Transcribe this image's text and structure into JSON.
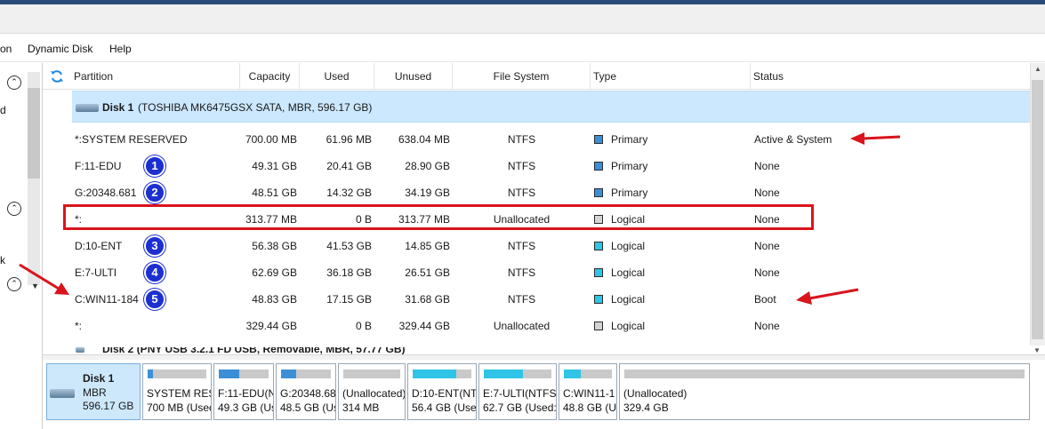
{
  "menu": {
    "item_partial": "on",
    "dynamic_disk": "Dynamic Disk",
    "help": "Help"
  },
  "left_panel": {
    "text_d": "d",
    "text_k": "k"
  },
  "table": {
    "headers": {
      "partition": "Partition",
      "capacity": "Capacity",
      "used": "Used",
      "unused": "Unused",
      "file_system": "File System",
      "type": "Type",
      "status": "Status"
    },
    "disk1_label": "Disk 1",
    "disk1_details": "(TOSHIBA MK6475GSX SATA, MBR, 596.17 GB)",
    "disk2_label_partial": "Disk 2 (PNY USB 3.2.1 FD USB, Removable, MBR, 57.77 GB)",
    "rows": [
      {
        "partition": "*:SYSTEM RESERVED",
        "capacity": "700.00 MB",
        "used": "61.96 MB",
        "unused": "638.04 MB",
        "fs": "NTFS",
        "type": "Primary",
        "status": "Active & System",
        "type_color": "#3c8fd6",
        "badge": ""
      },
      {
        "partition": "F:11-EDU",
        "capacity": "49.31 GB",
        "used": "20.41 GB",
        "unused": "28.90 GB",
        "fs": "NTFS",
        "type": "Primary",
        "status": "None",
        "type_color": "#3c8fd6",
        "badge": "1"
      },
      {
        "partition": "G:20348.681",
        "capacity": "48.51 GB",
        "used": "14.32 GB",
        "unused": "34.19 GB",
        "fs": "NTFS",
        "type": "Primary",
        "status": "None",
        "type_color": "#3c8fd6",
        "badge": "2"
      },
      {
        "partition": "*:",
        "capacity": "313.77 MB",
        "used": "0 B",
        "unused": "313.77 MB",
        "fs": "Unallocated",
        "type": "Logical",
        "status": "None",
        "type_color": "#d4d4d4",
        "badge": ""
      },
      {
        "partition": "D:10-ENT",
        "capacity": "56.38 GB",
        "used": "41.53 GB",
        "unused": "14.85 GB",
        "fs": "NTFS",
        "type": "Logical",
        "status": "None",
        "type_color": "#30c4e6",
        "badge": "3"
      },
      {
        "partition": "E:7-ULTI",
        "capacity": "62.69 GB",
        "used": "36.18 GB",
        "unused": "26.51 GB",
        "fs": "NTFS",
        "type": "Logical",
        "status": "None",
        "type_color": "#30c4e6",
        "badge": "4"
      },
      {
        "partition": "C:WIN11-184",
        "capacity": "48.83 GB",
        "used": "17.15 GB",
        "unused": "31.68 GB",
        "fs": "NTFS",
        "type": "Logical",
        "status": "Boot",
        "type_color": "#30c4e6",
        "badge": "5"
      },
      {
        "partition": "*:",
        "capacity": "329.44 GB",
        "used": "0 B",
        "unused": "329.44 GB",
        "fs": "Unallocated",
        "type": "Logical",
        "status": "None",
        "type_color": "#d4d4d4",
        "badge": ""
      }
    ]
  },
  "disk_map": {
    "disk_name": "Disk 1",
    "disk_style": "MBR",
    "disk_size": "596.17 GB",
    "segments": [
      {
        "line1": "SYSTEM RESE",
        "line2": "700 MB (Usec",
        "fill": 0.09,
        "color": "#3c8fd6"
      },
      {
        "line1": "F:11-EDU(N",
        "line2": "49.3 GB (Us",
        "fill": 0.41,
        "color": "#3c8fd6"
      },
      {
        "line1": "G:20348.681",
        "line2": "48.5 GB (Us",
        "fill": 0.3,
        "color": "#3c8fd6"
      },
      {
        "line1": "(Unallocated)",
        "line2": "314 MB",
        "fill": 0.0,
        "color": "#c9c9c9"
      },
      {
        "line1": "D:10-ENT(NT",
        "line2": "56.4 GB (Usec",
        "fill": 0.74,
        "color": "#30c4e6"
      },
      {
        "line1": "E:7-ULTI(NTFS)",
        "line2": "62.7 GB (Used:",
        "fill": 0.58,
        "color": "#30c4e6"
      },
      {
        "line1": "C:WIN11-1",
        "line2": "48.8 GB (Us",
        "fill": 0.35,
        "color": "#30c4e6"
      },
      {
        "line1": "(Unallocated)",
        "line2": "329.4 GB",
        "fill": 0.0,
        "color": "#c9c9c9"
      }
    ]
  },
  "colors": {
    "selection": "#cce8ff",
    "annotation_red": "#d9141b",
    "badge_blue": "#1c2fd1"
  }
}
